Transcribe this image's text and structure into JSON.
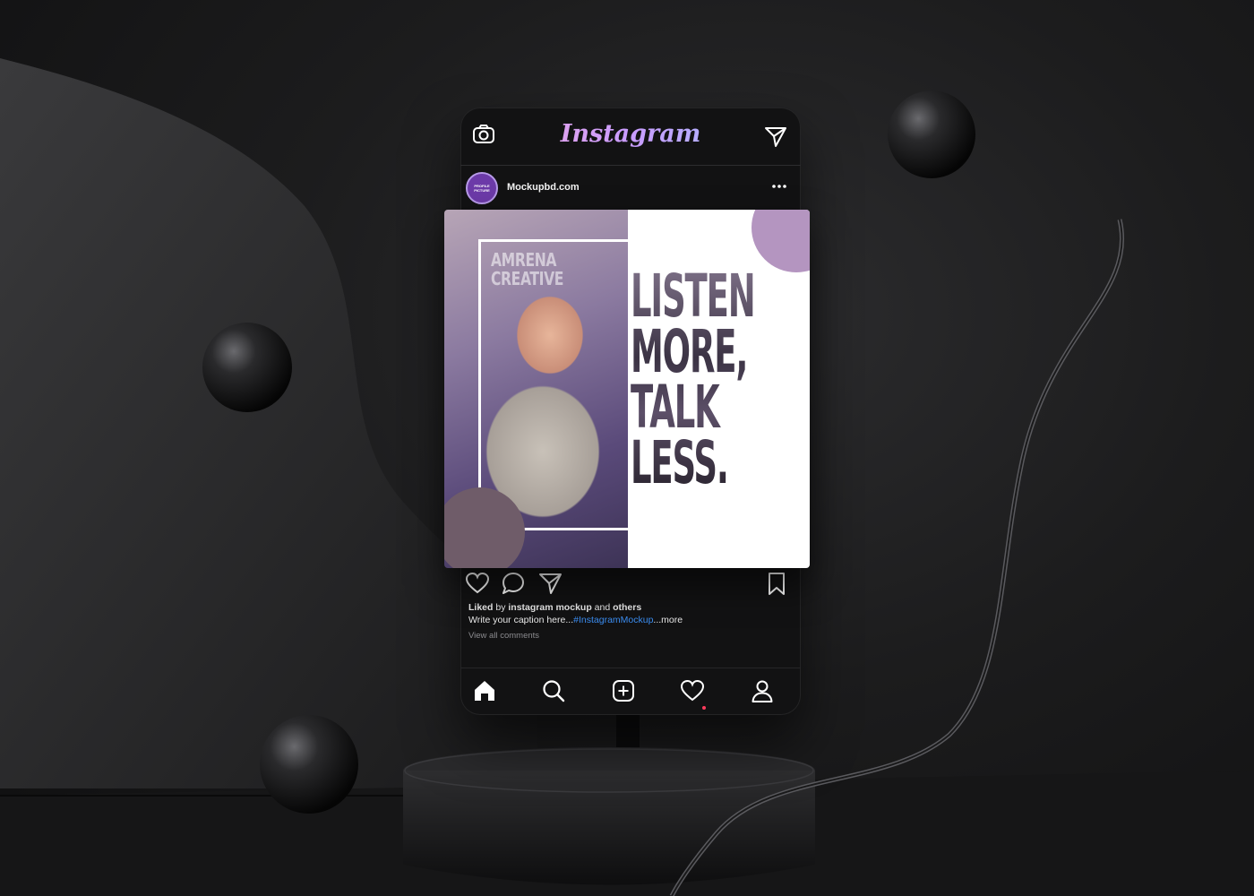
{
  "app": {
    "brand": "Instagram"
  },
  "post": {
    "avatar_text_line1": "PROFILE",
    "avatar_text_line2": "PICTURE",
    "username": "Mockupbd.com",
    "image": {
      "brand_line1": "AMRENA",
      "brand_line2": "CREATIVE",
      "quote_lines": [
        "LISTEN",
        "MORE,",
        "TALK",
        "LESS."
      ]
    },
    "likes": {
      "prefix": "Liked",
      "by": " by ",
      "user": "instagram mockup",
      "and": " and ",
      "others": "others"
    },
    "caption": {
      "text": "Write your caption here...",
      "hashtag": "#InstagramMockup",
      "more": "...more"
    },
    "view_all_comments": "View all comments"
  },
  "icons": {
    "top_left": "camera-icon",
    "top_right": "direct-message-icon",
    "post_menu": "more-options-icon",
    "actions": [
      "heart-icon",
      "comment-icon",
      "share-icon",
      "bookmark-icon"
    ],
    "nav": [
      "home-icon",
      "search-icon",
      "add-post-icon",
      "activity-heart-icon",
      "profile-icon"
    ]
  },
  "colors": {
    "phone_bg": "#121213",
    "hashtag": "#3b8df1",
    "notification_dot": "#ff3b5c",
    "accent_circle": "#b495c0"
  }
}
